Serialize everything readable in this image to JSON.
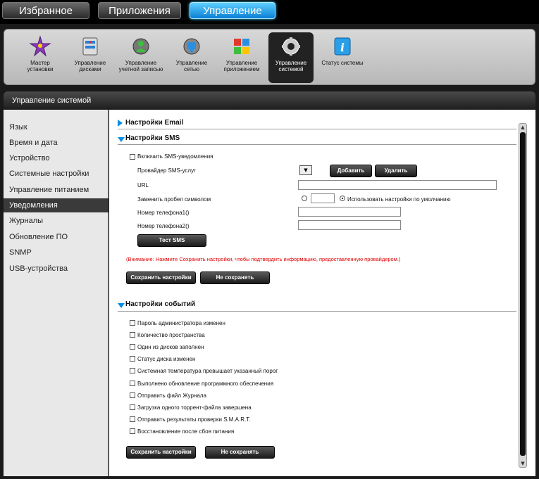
{
  "top_tabs": [
    "Избранное",
    "Приложения",
    "Управление"
  ],
  "icons": [
    {
      "label1": "Мастер",
      "label2": "установки",
      "icon": "wizard-icon"
    },
    {
      "label1": "Управление",
      "label2": "дисками",
      "icon": "disk-management-icon"
    },
    {
      "label1": "Управление",
      "label2": "учетной записью",
      "icon": "account-management-icon"
    },
    {
      "label1": "Управление",
      "label2": "сетью",
      "icon": "network-management-icon"
    },
    {
      "label1": "Управление",
      "label2": "приложением",
      "icon": "app-management-icon"
    },
    {
      "label1": "Управление",
      "label2": "системой",
      "icon": "system-management-icon"
    },
    {
      "label1": "Статус системы",
      "label2": "",
      "icon": "system-status-icon"
    }
  ],
  "section_header": "Управление системой",
  "sidebar": [
    "Язык",
    "Время и дата",
    "Устройство",
    "Системные настройки",
    "Управление питанием",
    "Уведомления",
    "Журналы",
    "Обновление ПО",
    "SNMP",
    "USB-устройства"
  ],
  "email": {
    "title": "Настройки Email"
  },
  "sms": {
    "title": "Настройки SMS",
    "enable": "Включить SMS-уведомления",
    "provider": "Провайдер SMS-услуг",
    "add": "Добавить",
    "delete": "Удалить",
    "url": "URL",
    "replace_space": "Заменить пробел символом",
    "use_default": "Использовать настройки по умолчанию",
    "phone1": "Номер телефона1()",
    "phone2": "Номер телефона2()",
    "test": "Тест SMS",
    "warning": "(Внимание: Нажмите Сохранить настройки, чтобы подтвердить информацию, предоставленную провайдером.)",
    "save": "Сохранить настройки",
    "cancel": "Не сохранять"
  },
  "events": {
    "title": "Настройки событий",
    "items": [
      "Пароль администратора изменен",
      "Количество пространства",
      "Один из дисков заполнен",
      "Статус диска изменен",
      "Системная температура превышает указанный порог",
      "Выполнено обновление программного обеспечения",
      "Отправить файл Журнала",
      "Загрузка одного торрент-файла завершена",
      "Отправить результаты проверки S.M.A.R.T.",
      "Восстановление после сбоя питания"
    ],
    "save": "Сохранить настройки",
    "cancel": "Не сохранять"
  },
  "colors": {
    "accent": "#0a8ee0",
    "warning": "#e00000"
  }
}
